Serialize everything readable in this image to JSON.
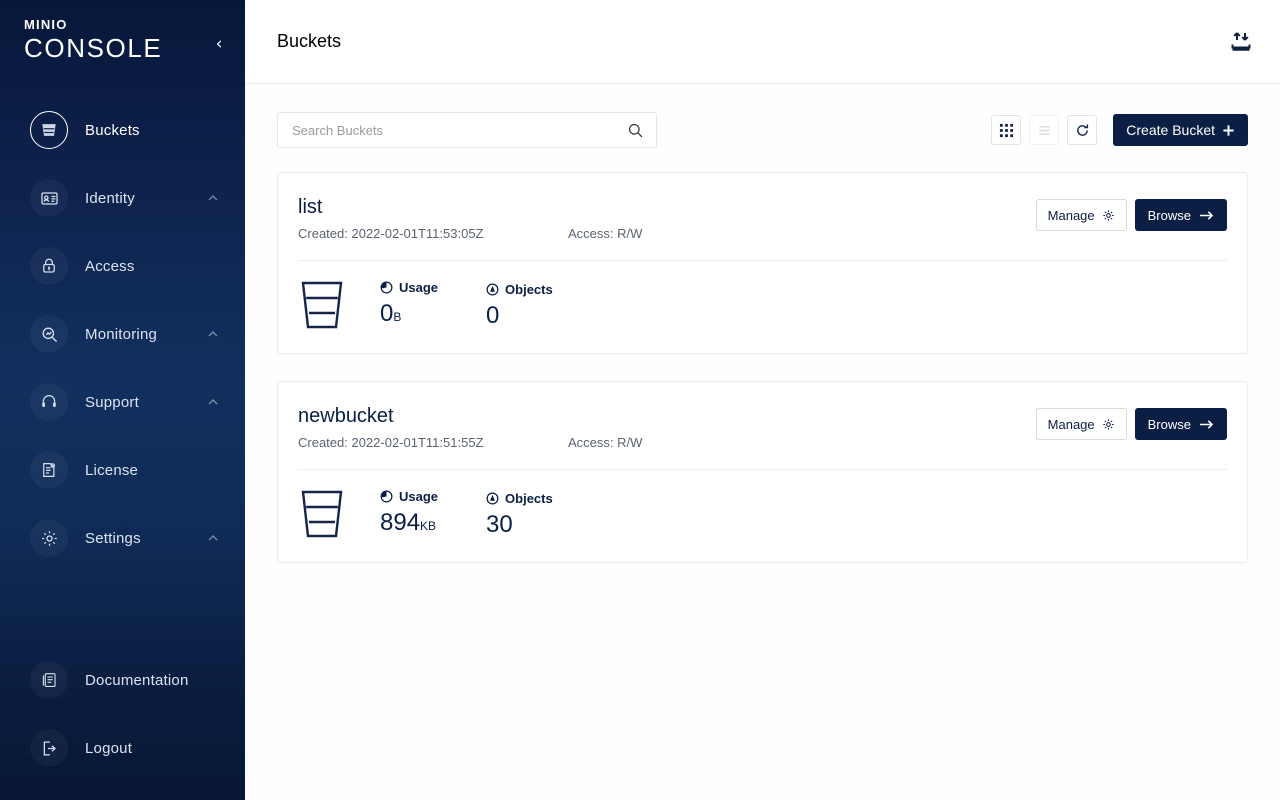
{
  "sidebar": {
    "logo_top": "MINIO",
    "logo_bottom": "CONSOLE",
    "collapse_label": "‹",
    "items": [
      {
        "label": "Buckets",
        "icon": "bucket-icon",
        "active": true,
        "expandable": false
      },
      {
        "label": "Identity",
        "icon": "identity-icon",
        "active": false,
        "expandable": true
      },
      {
        "label": "Access",
        "icon": "lock-icon",
        "active": false,
        "expandable": false
      },
      {
        "label": "Monitoring",
        "icon": "magnifier-icon",
        "active": false,
        "expandable": true
      },
      {
        "label": "Support",
        "icon": "support-icon",
        "active": false,
        "expandable": true
      },
      {
        "label": "License",
        "icon": "license-icon",
        "active": false,
        "expandable": false
      },
      {
        "label": "Settings",
        "icon": "gear-icon",
        "active": false,
        "expandable": true
      }
    ],
    "bottom_items": [
      {
        "label": "Documentation",
        "icon": "book-icon"
      },
      {
        "label": "Logout",
        "icon": "logout-icon"
      }
    ]
  },
  "header": {
    "title": "Buckets",
    "transfer_icon": "upload-download-icon"
  },
  "toolbar": {
    "search_placeholder": "Search Buckets",
    "search_value": "",
    "search_icon": "search-icon",
    "grid_view_icon": "grid-view-icon",
    "list_view_icon": "list-view-icon",
    "refresh_icon": "refresh-icon",
    "create_bucket_label": "Create Bucket",
    "create_bucket_plus": "✛"
  },
  "labels": {
    "created_prefix": "Created:",
    "access_prefix": "Access:",
    "usage_label": "Usage",
    "objects_label": "Objects",
    "manage_label": "Manage",
    "browse_label": "Browse"
  },
  "buckets": [
    {
      "name": "list",
      "created": "Created: 2022-02-01T11:53:05Z",
      "access": "Access: R/W",
      "usage_value": "0",
      "usage_unit": "B",
      "objects_value": "0"
    },
    {
      "name": "newbucket",
      "created": "Created: 2022-02-01T11:51:55Z",
      "access": "Access: R/W",
      "usage_value": "894",
      "usage_unit": "KB",
      "objects_value": "30"
    }
  ],
  "colors": {
    "brand_navy": "#0b1e44",
    "sidebar_top": "#071738",
    "sidebar_mid": "#11305f",
    "page_bg": "#fefefe"
  }
}
